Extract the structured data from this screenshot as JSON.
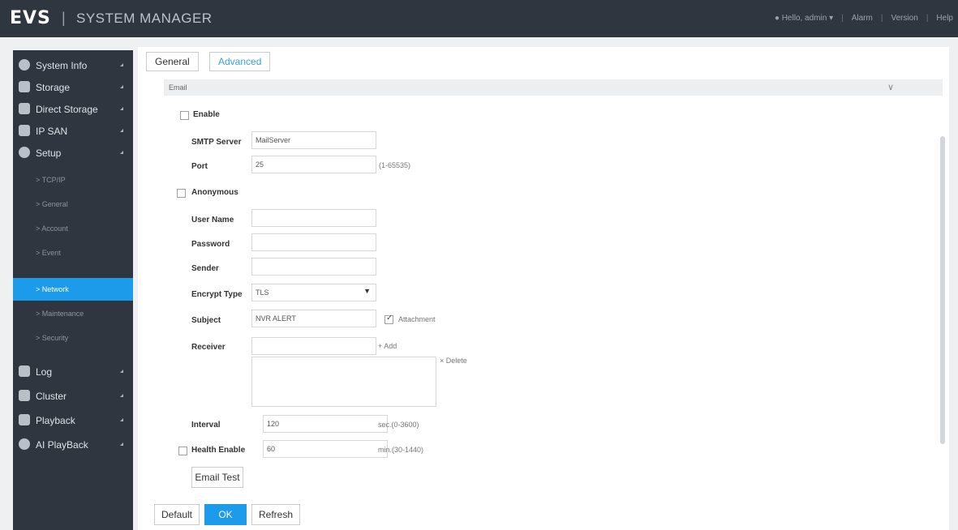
{
  "header": {
    "logo": "EVS",
    "separator": "|",
    "title": "SYSTEM MANAGER",
    "user_menu": "Hello, admin",
    "alarm": "Alarm",
    "version": "Version",
    "help": "Help"
  },
  "sidebar": {
    "items": [
      {
        "label": "System Info",
        "icon": "info-icon"
      },
      {
        "label": "Storage",
        "icon": "disk-icon"
      },
      {
        "label": "Direct Storage",
        "icon": "direct-storage-icon"
      },
      {
        "label": "IP SAN",
        "icon": "san-icon"
      },
      {
        "label": "Setup",
        "icon": "gear-icon"
      }
    ],
    "sub_items": [
      "> TCP/IP",
      "> General",
      "> Account",
      "> Event",
      "> Network",
      "> Maintenance",
      "> Security"
    ],
    "items_bottom": [
      {
        "label": "Log",
        "icon": "log-icon"
      },
      {
        "label": "Cluster",
        "icon": "cluster-icon"
      },
      {
        "label": "Playback",
        "icon": "playback-icon"
      },
      {
        "label": "AI PlayBack",
        "icon": "ai-playback-icon"
      }
    ]
  },
  "tabs": {
    "general": "General",
    "advanced": "Advanced"
  },
  "section_title": "Email",
  "form": {
    "enable": "Enable",
    "smtp_label": "SMTP Server",
    "smtp_value": "MailServer",
    "port_label": "Port",
    "port_value": "25",
    "port_hint": "(1-65535)",
    "anonymous": "Anonymous",
    "username_label": "User Name",
    "password_label": "Password",
    "sender_label": "Sender",
    "encrypt_label": "Encrypt Type",
    "encrypt_value": "TLS",
    "subject_label": "Subject",
    "subject_value": "NVR ALERT",
    "attachment": "Attachment",
    "receiver_label": "Receiver",
    "add": "+ Add",
    "delete": "× Delete",
    "interval_label": "Interval",
    "interval_value": "120",
    "interval_hint": "sec.(0-3600)",
    "health_label": "Health Enable",
    "health_value": "60",
    "health_hint": "min.(30-1440)",
    "email_test": "Email Test"
  },
  "footer": {
    "default": "Default",
    "ok": "OK",
    "refresh": "Refresh"
  },
  "colors": {
    "accent": "#1c9bea",
    "sidebar": "#2f3640",
    "topbar": "#2f3640"
  }
}
